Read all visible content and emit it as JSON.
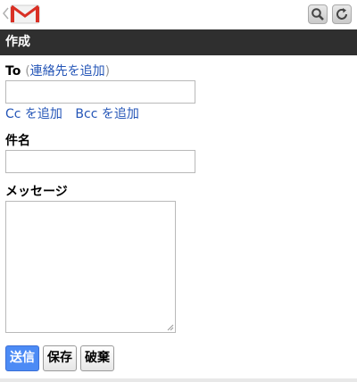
{
  "header": {
    "title": "作成"
  },
  "toolbar": {
    "search_icon": "search-icon",
    "refresh_icon": "refresh-icon"
  },
  "compose": {
    "to_label": "To",
    "to_paren_open": "(",
    "add_contact": "連絡先を追加",
    "to_paren_close": ")",
    "to_value": "",
    "add_cc": "Cc を追加",
    "add_bcc": "Bcc を追加",
    "subject_label": "件名",
    "subject_value": "",
    "message_label": "メッセージ",
    "message_value": ""
  },
  "actions": {
    "send": "送信",
    "save": "保存",
    "discard": "破棄"
  },
  "colors": {
    "accent": "#4c8bf5",
    "link": "#2455b7",
    "header_bg": "#2f2f2f",
    "logo_red": "#d93025"
  }
}
